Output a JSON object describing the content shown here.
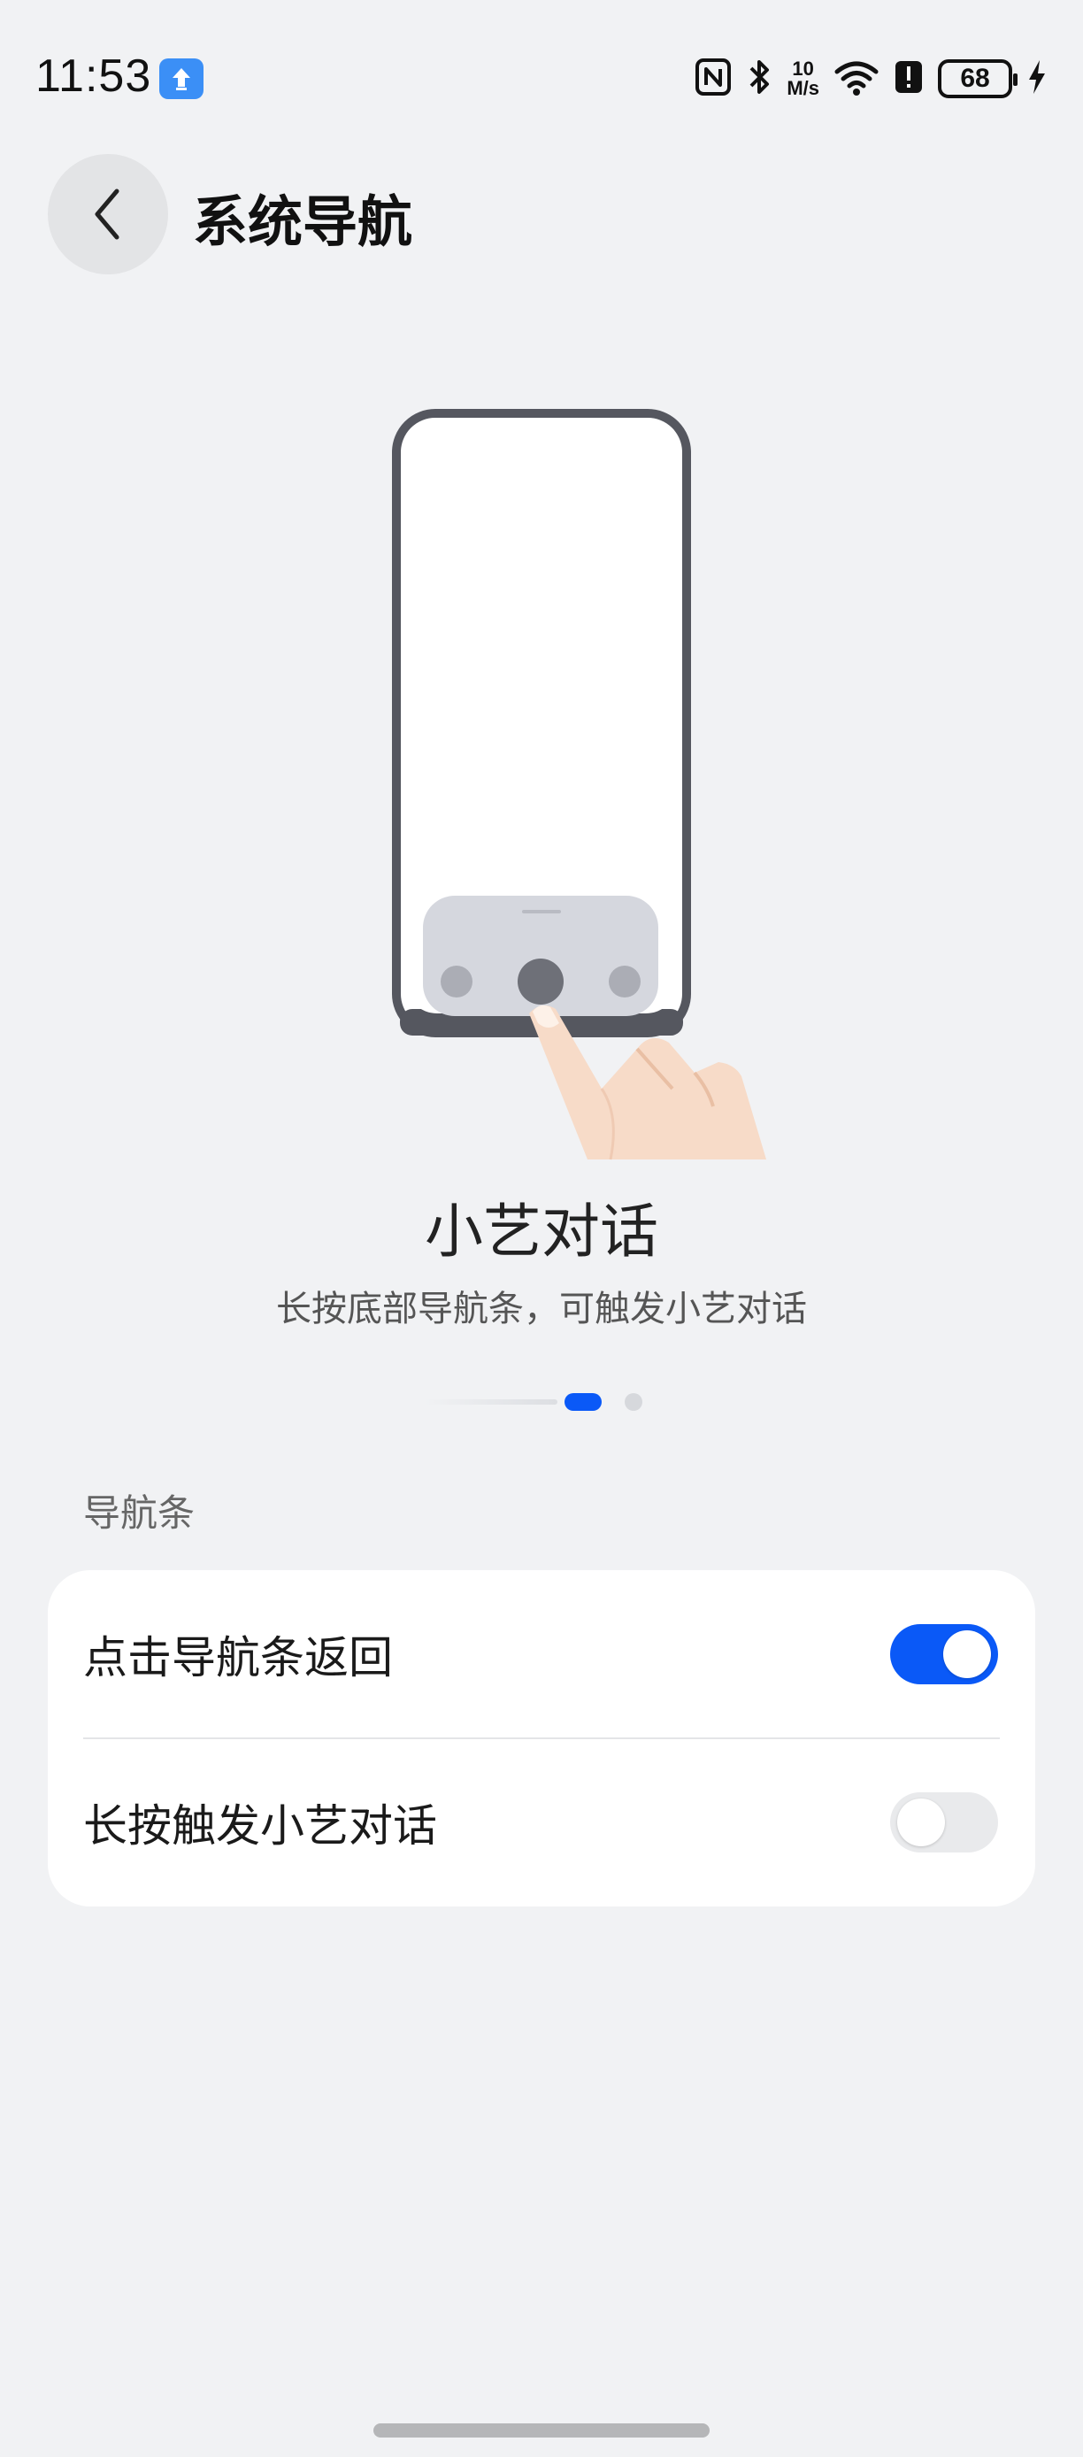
{
  "status_bar": {
    "time": "11:53",
    "network_speed_value": "10",
    "network_speed_unit": "M/s",
    "battery_level": "68",
    "icons": [
      "notification-upload-icon",
      "nfc-icon",
      "bluetooth-icon",
      "wifi-icon",
      "alert-icon",
      "battery-icon",
      "charging-icon"
    ]
  },
  "header": {
    "title": "系统导航",
    "back_icon": "chevron-left-icon"
  },
  "feature": {
    "title": "小艺对话",
    "description": "长按底部导航条，可触发小艺对话",
    "page_count": 3,
    "active_page": 2
  },
  "section": {
    "label": "导航条"
  },
  "settings": [
    {
      "label": "点击导航条返回",
      "enabled": true
    },
    {
      "label": "长按触发小艺对话",
      "enabled": false
    }
  ],
  "colors": {
    "accent": "#0a59f7",
    "background": "#f1f2f4",
    "card": "#ffffff"
  }
}
